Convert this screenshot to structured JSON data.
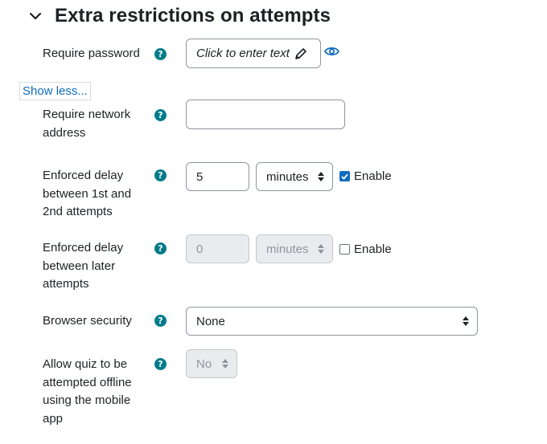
{
  "section": {
    "title": "Extra restrictions on attempts"
  },
  "show_less": "Show less...",
  "fields": {
    "require_password": {
      "label": "Require password",
      "placeholder": "Click to enter text"
    },
    "require_network": {
      "label_lines": [
        "Require network",
        "address"
      ],
      "value": ""
    },
    "delay_first": {
      "label_lines": [
        "Enforced delay",
        "between 1st and",
        "2nd attempts"
      ],
      "value": "5",
      "unit": "minutes",
      "enable_label": "Enable",
      "enabled": true
    },
    "delay_later": {
      "label_lines": [
        "Enforced delay",
        "between later",
        "attempts"
      ],
      "value": "0",
      "unit": "minutes",
      "enable_label": "Enable",
      "enabled": false
    },
    "browser_security": {
      "label": "Browser security",
      "value": "None"
    },
    "offline": {
      "label_lines": [
        "Allow quiz to be",
        "attempted offline",
        "using the mobile",
        "app"
      ],
      "value": "No"
    }
  },
  "help_glyph": "?",
  "colors": {
    "help": "#007b8a",
    "link": "#0f6cbf",
    "checkbox": "#0f6cbf"
  }
}
